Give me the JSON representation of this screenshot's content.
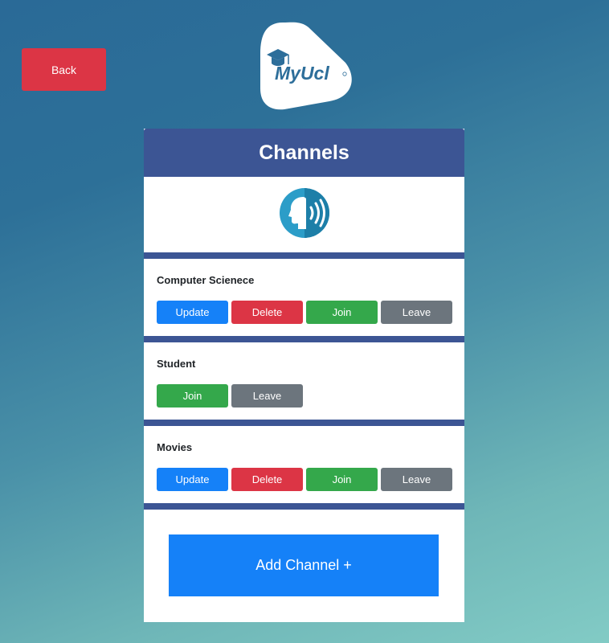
{
  "back_label": "Back",
  "logo": {
    "text": "MyUcl",
    "icon": "graduation-cap-icon"
  },
  "card": {
    "title": "Channels",
    "icon": "speaking-head-icon",
    "channels": [
      {
        "name": "Computer Scienece",
        "buttons": [
          "Update",
          "Delete",
          "Join",
          "Leave"
        ]
      },
      {
        "name": "Student",
        "buttons": [
          "Join",
          "Leave"
        ]
      },
      {
        "name": "Movies",
        "buttons": [
          "Update",
          "Delete",
          "Join",
          "Leave"
        ]
      }
    ],
    "add_label": "Add Channel +"
  },
  "colors": {
    "header": "#3c5594",
    "back": "#dc3545",
    "update": "#1581f8",
    "delete": "#dc3545",
    "join": "#34a84b",
    "leave": "#6c757d",
    "add": "#1581f8"
  }
}
